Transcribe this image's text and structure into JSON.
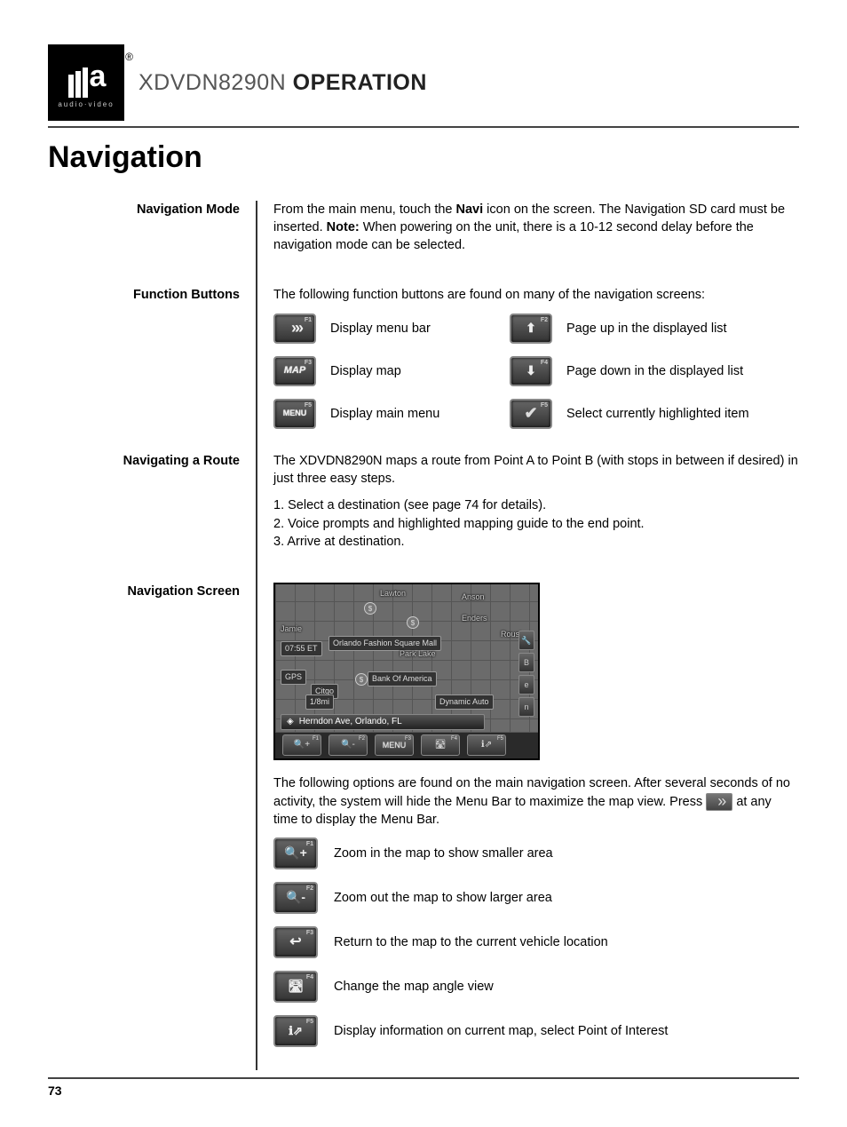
{
  "logo": {
    "sub": "audio·video",
    "registered": "®"
  },
  "header_title_model": "XDVDN8290N",
  "header_title_word": "OPERATION",
  "section_title": "Navigation",
  "page_number": "73",
  "rows": {
    "nav_mode": {
      "label": "Navigation Mode",
      "text_pre": "From the main menu, touch the ",
      "navi": "Navi",
      "text_mid": " icon on the screen. The Navigation SD card must be inserted. ",
      "note": "Note:",
      "text_post": " When powering on the unit, there is a 10-12 second delay before the navigation mode can be selected."
    },
    "func_buttons": {
      "label": "Function Buttons",
      "intro": "The following function buttons are found on many of the navigation screens:",
      "items": [
        {
          "btn_key": "menu_bar_chevrons",
          "desc": "Display menu bar",
          "f": "F1"
        },
        {
          "btn_key": "page_up",
          "desc": "Page up in the displayed list",
          "f": "F2"
        },
        {
          "btn_key": "map",
          "btn_label": "MAP",
          "desc": "Display map",
          "f": "F3"
        },
        {
          "btn_key": "page_down",
          "desc": "Page down in the displayed list",
          "f": "F4"
        },
        {
          "btn_key": "menu",
          "btn_label": "MENU",
          "desc": "Display main menu",
          "f": "F5"
        },
        {
          "btn_key": "select",
          "desc": "Select currently highlighted item",
          "f": "F5"
        }
      ]
    },
    "navigating_route": {
      "label": "Navigating a Route",
      "intro": "The XDVDN8290N maps a route from Point A to Point B (with stops in between if desired) in just three easy steps.",
      "steps": [
        "1. Select a destination (see page 74 for details).",
        "2. Voice prompts and highlighted mapping guide to the end point.",
        "3. Arrive at destination."
      ]
    },
    "nav_screen": {
      "label": "Navigation Screen",
      "screenshot": {
        "labels": [
          "Lawton",
          "Anson",
          "Enders",
          "Jamie",
          "Roush",
          "Orlando Fashion Square Mall",
          "Park Lake",
          "Bank Of America",
          "Dynamic Auto"
        ],
        "time": "07:55 ET",
        "gps": "GPS",
        "distance": "1/8mi",
        "citgo": "Citgo",
        "status": "Herndon Ave, Orlando, FL",
        "sidebar": [
          "B",
          "e",
          "n"
        ],
        "menubar_labels": [
          "",
          "",
          "MENU",
          "",
          ""
        ],
        "menubar_f": [
          "F1",
          "F2",
          "F3",
          "F4",
          "F5"
        ]
      },
      "desc_pre": "The following options are found on the main navigation screen. After several seconds of no activity, the system will hide the Menu Bar to maximize the map view. Press ",
      "desc_post": " at any time to display the Menu Bar.",
      "options": [
        {
          "key": "zoom_in",
          "f": "F1",
          "desc": "Zoom in the map to show smaller area"
        },
        {
          "key": "zoom_out",
          "f": "F2",
          "desc": "Zoom out the map to show larger area"
        },
        {
          "key": "return",
          "f": "F3",
          "desc": "Return to the map to the current vehicle location"
        },
        {
          "key": "angle",
          "f": "F4",
          "desc": "Change the map angle view"
        },
        {
          "key": "info",
          "f": "F5",
          "desc": "Display information on current map, select Point of Interest"
        }
      ]
    }
  }
}
